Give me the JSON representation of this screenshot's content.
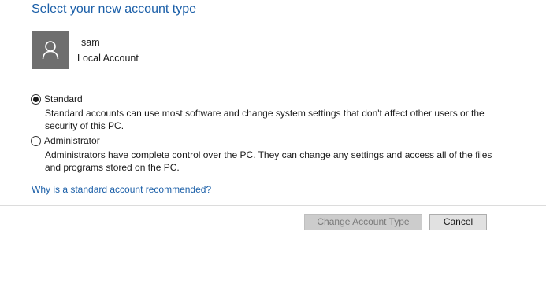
{
  "header": {
    "title": "Select your new account type"
  },
  "account": {
    "icon": "user-icon",
    "name": "sam",
    "type": "Local Account"
  },
  "options": [
    {
      "label": "Standard",
      "selected": true,
      "description": "Standard accounts can use most software and change system settings that don't affect other users or the security of this PC."
    },
    {
      "label": "Administrator",
      "selected": false,
      "description": "Administrators have complete control over the PC. They can change any settings and access all of the files and programs stored on the PC."
    }
  ],
  "help_link": "Why is a standard account recommended?",
  "buttons": {
    "change": {
      "label": "Change Account Type",
      "enabled": false
    },
    "cancel": {
      "label": "Cancel",
      "enabled": true
    }
  },
  "colors": {
    "accent": "#1b5fa8",
    "avatar_bg": "#6e6e6e"
  }
}
